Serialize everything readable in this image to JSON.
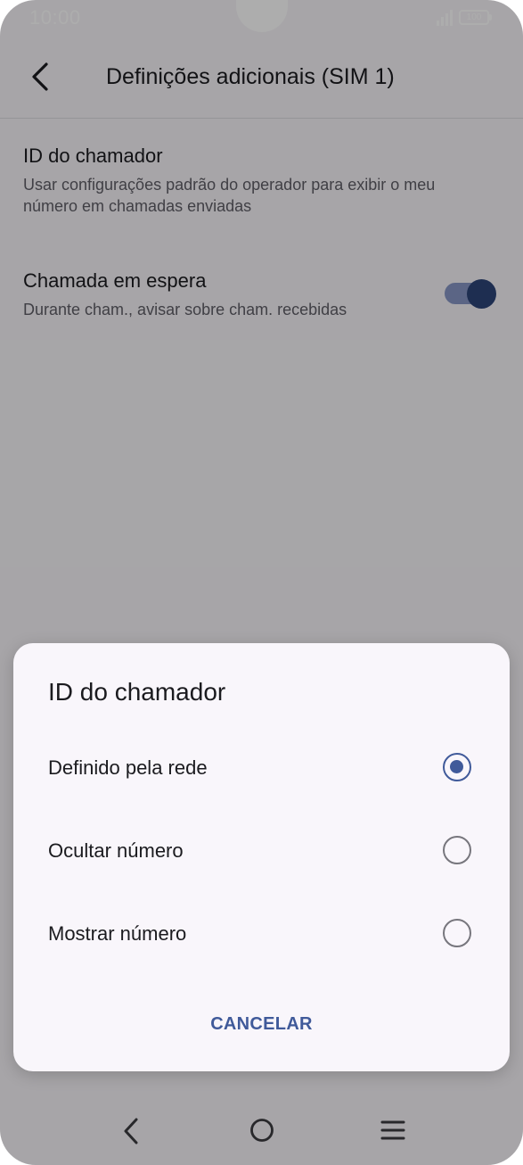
{
  "status_bar": {
    "time": "10:00",
    "battery": "100",
    "icons": [
      "signal-icon",
      "battery-icon"
    ]
  },
  "app_bar": {
    "title": "Definições adicionais (SIM 1)",
    "back_icon": "back-arrow-icon"
  },
  "settings": [
    {
      "title": "ID do chamador",
      "summary": "Usar configurações padrão do operador para exibir o meu número em chamadas enviadas"
    },
    {
      "title": "Chamada em espera",
      "summary": "Durante cham., avisar sobre cham. recebidas",
      "toggle_on": true
    }
  ],
  "dialog": {
    "title": "ID do chamador",
    "options": [
      {
        "label": "Definido pela rede",
        "selected": true
      },
      {
        "label": "Ocultar número",
        "selected": false
      },
      {
        "label": "Mostrar número",
        "selected": false
      }
    ],
    "cancel_label": "CANCELAR"
  },
  "nav_bar": {
    "icons": [
      "nav-back-icon",
      "nav-home-icon",
      "nav-menu-icon"
    ]
  },
  "colors": {
    "accent": "#405a9a",
    "toggle_track": "#8696c4",
    "toggle_thumb": "#2d4478",
    "dialog_background": "#f9f6fb"
  }
}
